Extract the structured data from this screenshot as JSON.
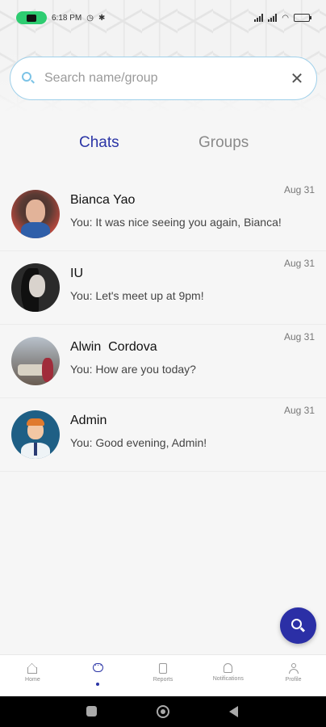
{
  "status_bar": {
    "time": "6:18 PM",
    "icons": [
      "camera-pill",
      "alarm-icon",
      "cat-icon",
      "signal-icon",
      "signal-icon",
      "wifi-icon",
      "battery-icon"
    ]
  },
  "search": {
    "placeholder": "Search name/group",
    "value": "",
    "icon": "search-icon",
    "clear_icon": "close-icon"
  },
  "tabs": [
    {
      "label": "Chats",
      "active": true
    },
    {
      "label": "Groups",
      "active": false
    }
  ],
  "chats": [
    {
      "name": "Bianca Yao",
      "preview": "You: It was nice seeing you again, Bianca!",
      "date": "Aug 31"
    },
    {
      "name": "IU",
      "preview": "You: Let's meet up at 9pm!",
      "date": "Aug 31"
    },
    {
      "name": "Alwin  Cordova",
      "preview": "You: How are you today?",
      "date": "Aug 31"
    },
    {
      "name": "Admin",
      "preview": "You: Good evening, Admin!",
      "date": "Aug 31"
    }
  ],
  "fab": {
    "icon": "search-icon"
  },
  "bottom_nav": [
    {
      "label": "Home",
      "icon": "home-icon",
      "active": false
    },
    {
      "label": "",
      "icon": "chat-icon",
      "active": true
    },
    {
      "label": "Reports",
      "icon": "reports-icon",
      "active": false
    },
    {
      "label": "Notifications",
      "icon": "bell-icon",
      "active": false
    },
    {
      "label": "Profile",
      "icon": "profile-icon",
      "active": false
    }
  ],
  "colors": {
    "accent": "#2b35a6",
    "search_border": "#9fd0ea",
    "status_pill": "#2ecc71"
  }
}
